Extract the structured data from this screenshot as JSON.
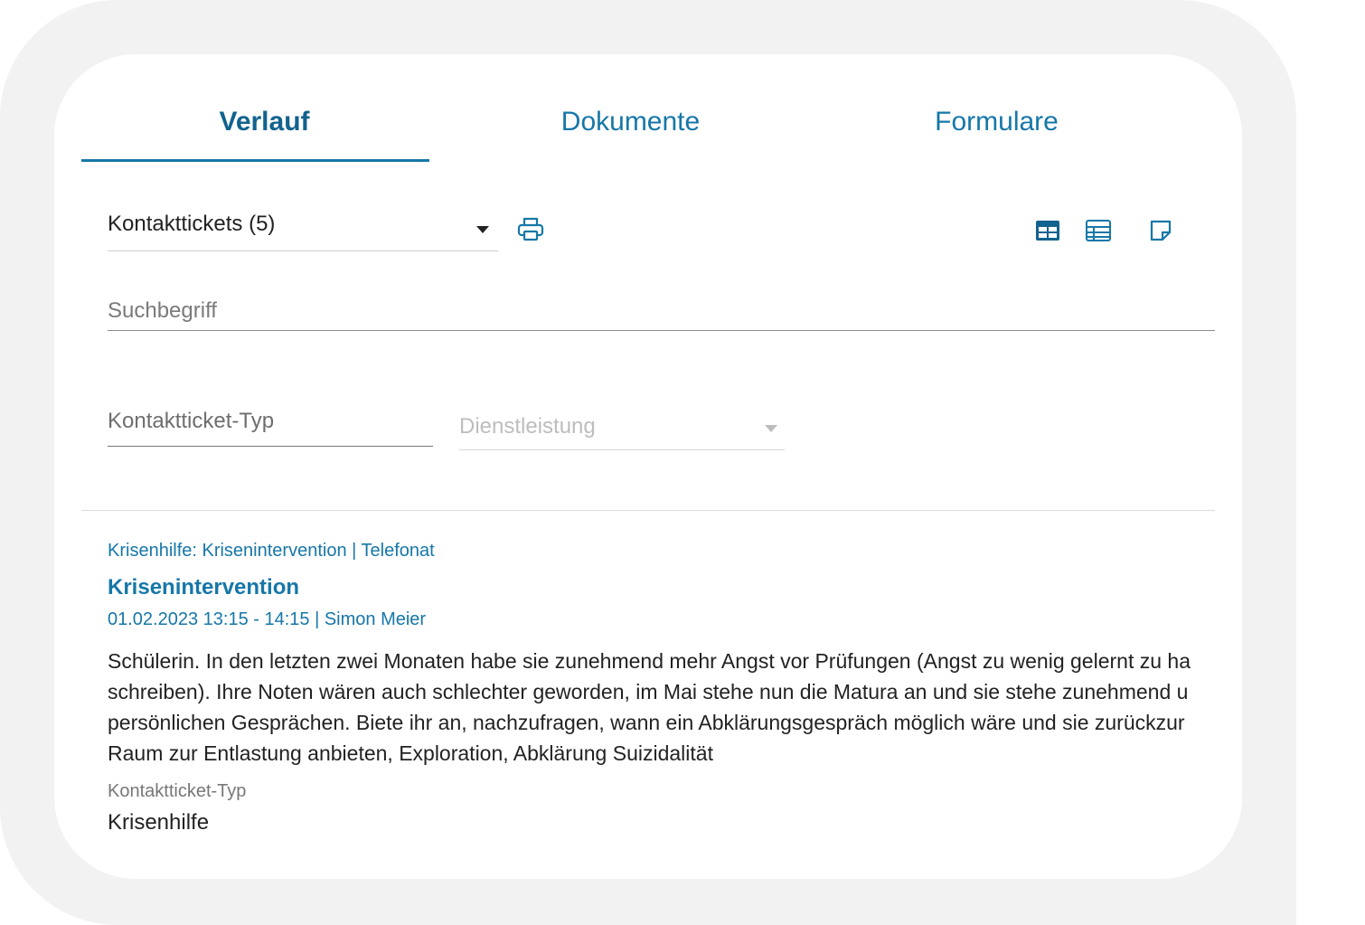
{
  "tabs": [
    {
      "label": "Verlauf",
      "active": true
    },
    {
      "label": "Dokumente",
      "active": false
    },
    {
      "label": "Formulare",
      "active": false
    }
  ],
  "filter": {
    "selected": "Kontakttickets (5)"
  },
  "icons": {
    "print": "printer-icon",
    "view_card": "table-view-filled-icon",
    "view_table": "table-view-outline-icon",
    "view_note": "note-icon"
  },
  "search": {
    "placeholder": "Suchbegriff"
  },
  "filters": {
    "type_label": "Kontaktticket-Typ",
    "service_label": "Dienstleistung"
  },
  "entry": {
    "category": "Krisenhilfe: Krisenintervention | Telefonat",
    "title": "Krisenintervention",
    "date_author": "01.02.2023 13:15 - 14:15 | Simon Meier",
    "body_lines": [
      "Schülerin. In den letzten zwei Monaten habe sie zunehmend mehr Angst vor Prüfungen (Angst zu wenig gelernt zu ha",
      "schreiben). Ihre Noten wären auch schlechter geworden, im Mai stehe nun die Matura an und sie stehe zunehmend u",
      "persönlichen Gesprächen. Biete ihr an, nachzufragen, wann ein Abklärungsgespräch möglich wäre und sie zurückzur",
      "Raum zur Entlastung anbieten, Exploration, Abklärung Suizidalität"
    ],
    "type_label": "Kontaktticket-Typ",
    "type_value": "Krisenhilfe"
  },
  "colors": {
    "accent": "#1677a8",
    "accent_dark": "#12638e",
    "frame_bg": "#f2f2f2"
  }
}
